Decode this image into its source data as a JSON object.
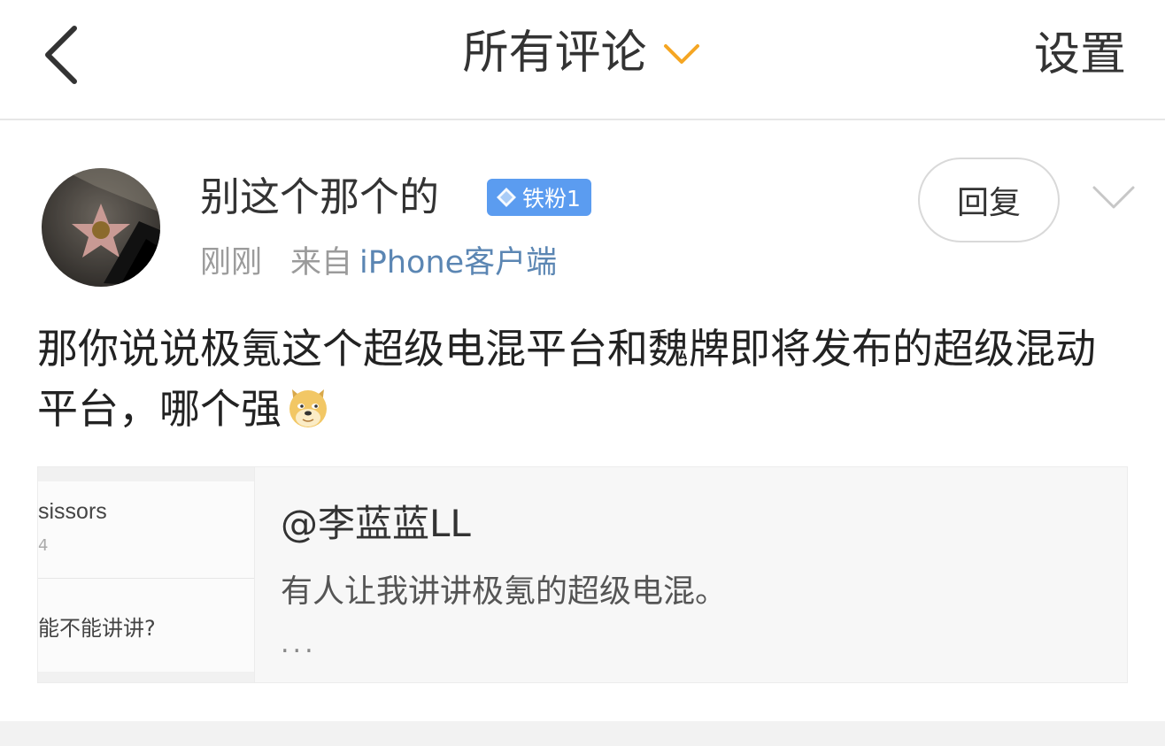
{
  "header": {
    "title": "所有评论",
    "settings_label": "设置"
  },
  "comment": {
    "username": "别这个那个的",
    "badge_label": "铁粉1",
    "time": "刚刚",
    "from_label": "来自",
    "client": "iPhone客户端",
    "reply_label": "回复",
    "text": "那你说说极氪这个超级电混平台和魏牌即将发布的超级混动平台，哪个强"
  },
  "quote": {
    "thumb_text_1": "sissors",
    "thumb_sub": "4",
    "thumb_text_2": "能不能讲讲?",
    "author": "@李蓝蓝LL",
    "text": "有人让我讲讲极氪的超级电混。",
    "ellipsis": "..."
  },
  "colors": {
    "accent": "#f5a623",
    "badge": "#5b9cf0",
    "link": "#5b86b3"
  },
  "icons": {
    "back": "back-chevron-icon",
    "title_dropdown": "chevron-down-icon",
    "more": "chevron-down-icon",
    "badge": "diamond-icon",
    "emoji": "doge-icon"
  }
}
